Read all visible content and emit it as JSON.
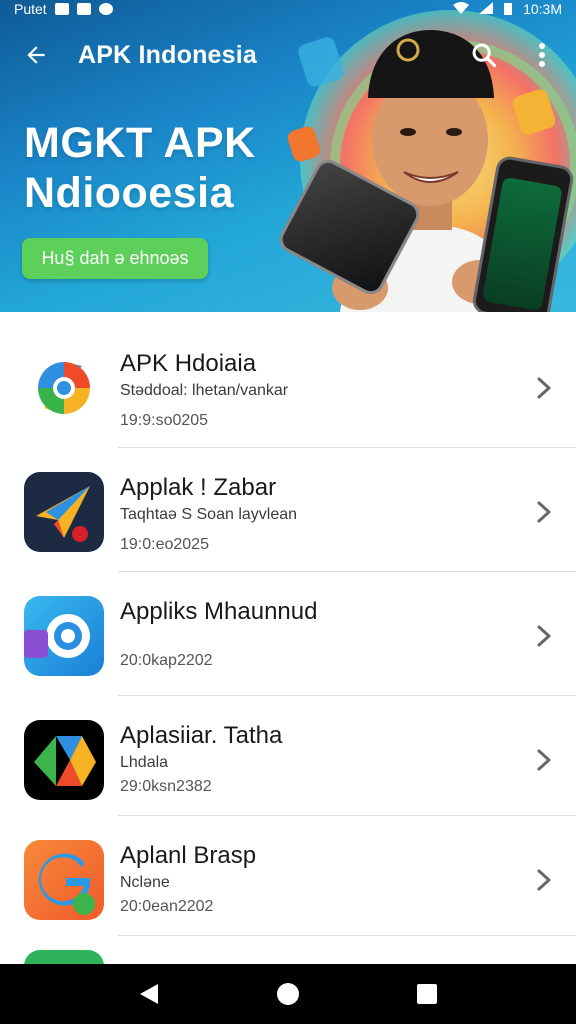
{
  "status_bar": {
    "carrier": "Putet",
    "time": "10:3M"
  },
  "app_bar": {
    "title": "APK Indonesia",
    "back_icon": "arrow-left-icon",
    "search_icon": "search-icon",
    "menu_icon": "more-vert-icon"
  },
  "hero": {
    "title_line1": "MGKT APK",
    "title_line2": "Ndiooesia",
    "cta_label": "Hu§ dah ə ehnoəs",
    "colors": {
      "bg": "#1a86c9",
      "cta": "#5cd05a"
    }
  },
  "apps": [
    {
      "title": "APK Hdoiaia",
      "subtitle": "Stəddoal: lhetan/vankar",
      "date": "19:9:so0205",
      "icon": "chrome-swirl-icon"
    },
    {
      "title": "Applak ! Zabar",
      "subtitle": "Taqhtaə S Soan layvlean",
      "date": "19:0:eo2025",
      "icon": "paper-plane-icon"
    },
    {
      "title": "Appliks Mhaunnud",
      "subtitle": "",
      "date": "20:0kap2202",
      "icon": "ring-target-icon"
    },
    {
      "title": "Aplasiiar. Tatha",
      "subtitle": "Lhdala",
      "date": "29:0ksn2382",
      "icon": "colorful-a-icon"
    },
    {
      "title": "Aplanl Brasp",
      "subtitle": "Ncləne",
      "date": "20:0ean2202",
      "icon": "g-letter-icon"
    }
  ],
  "nav": {
    "back_icon": "triangle-back-icon",
    "home_icon": "circle-home-icon",
    "recents_icon": "square-recents-icon"
  }
}
